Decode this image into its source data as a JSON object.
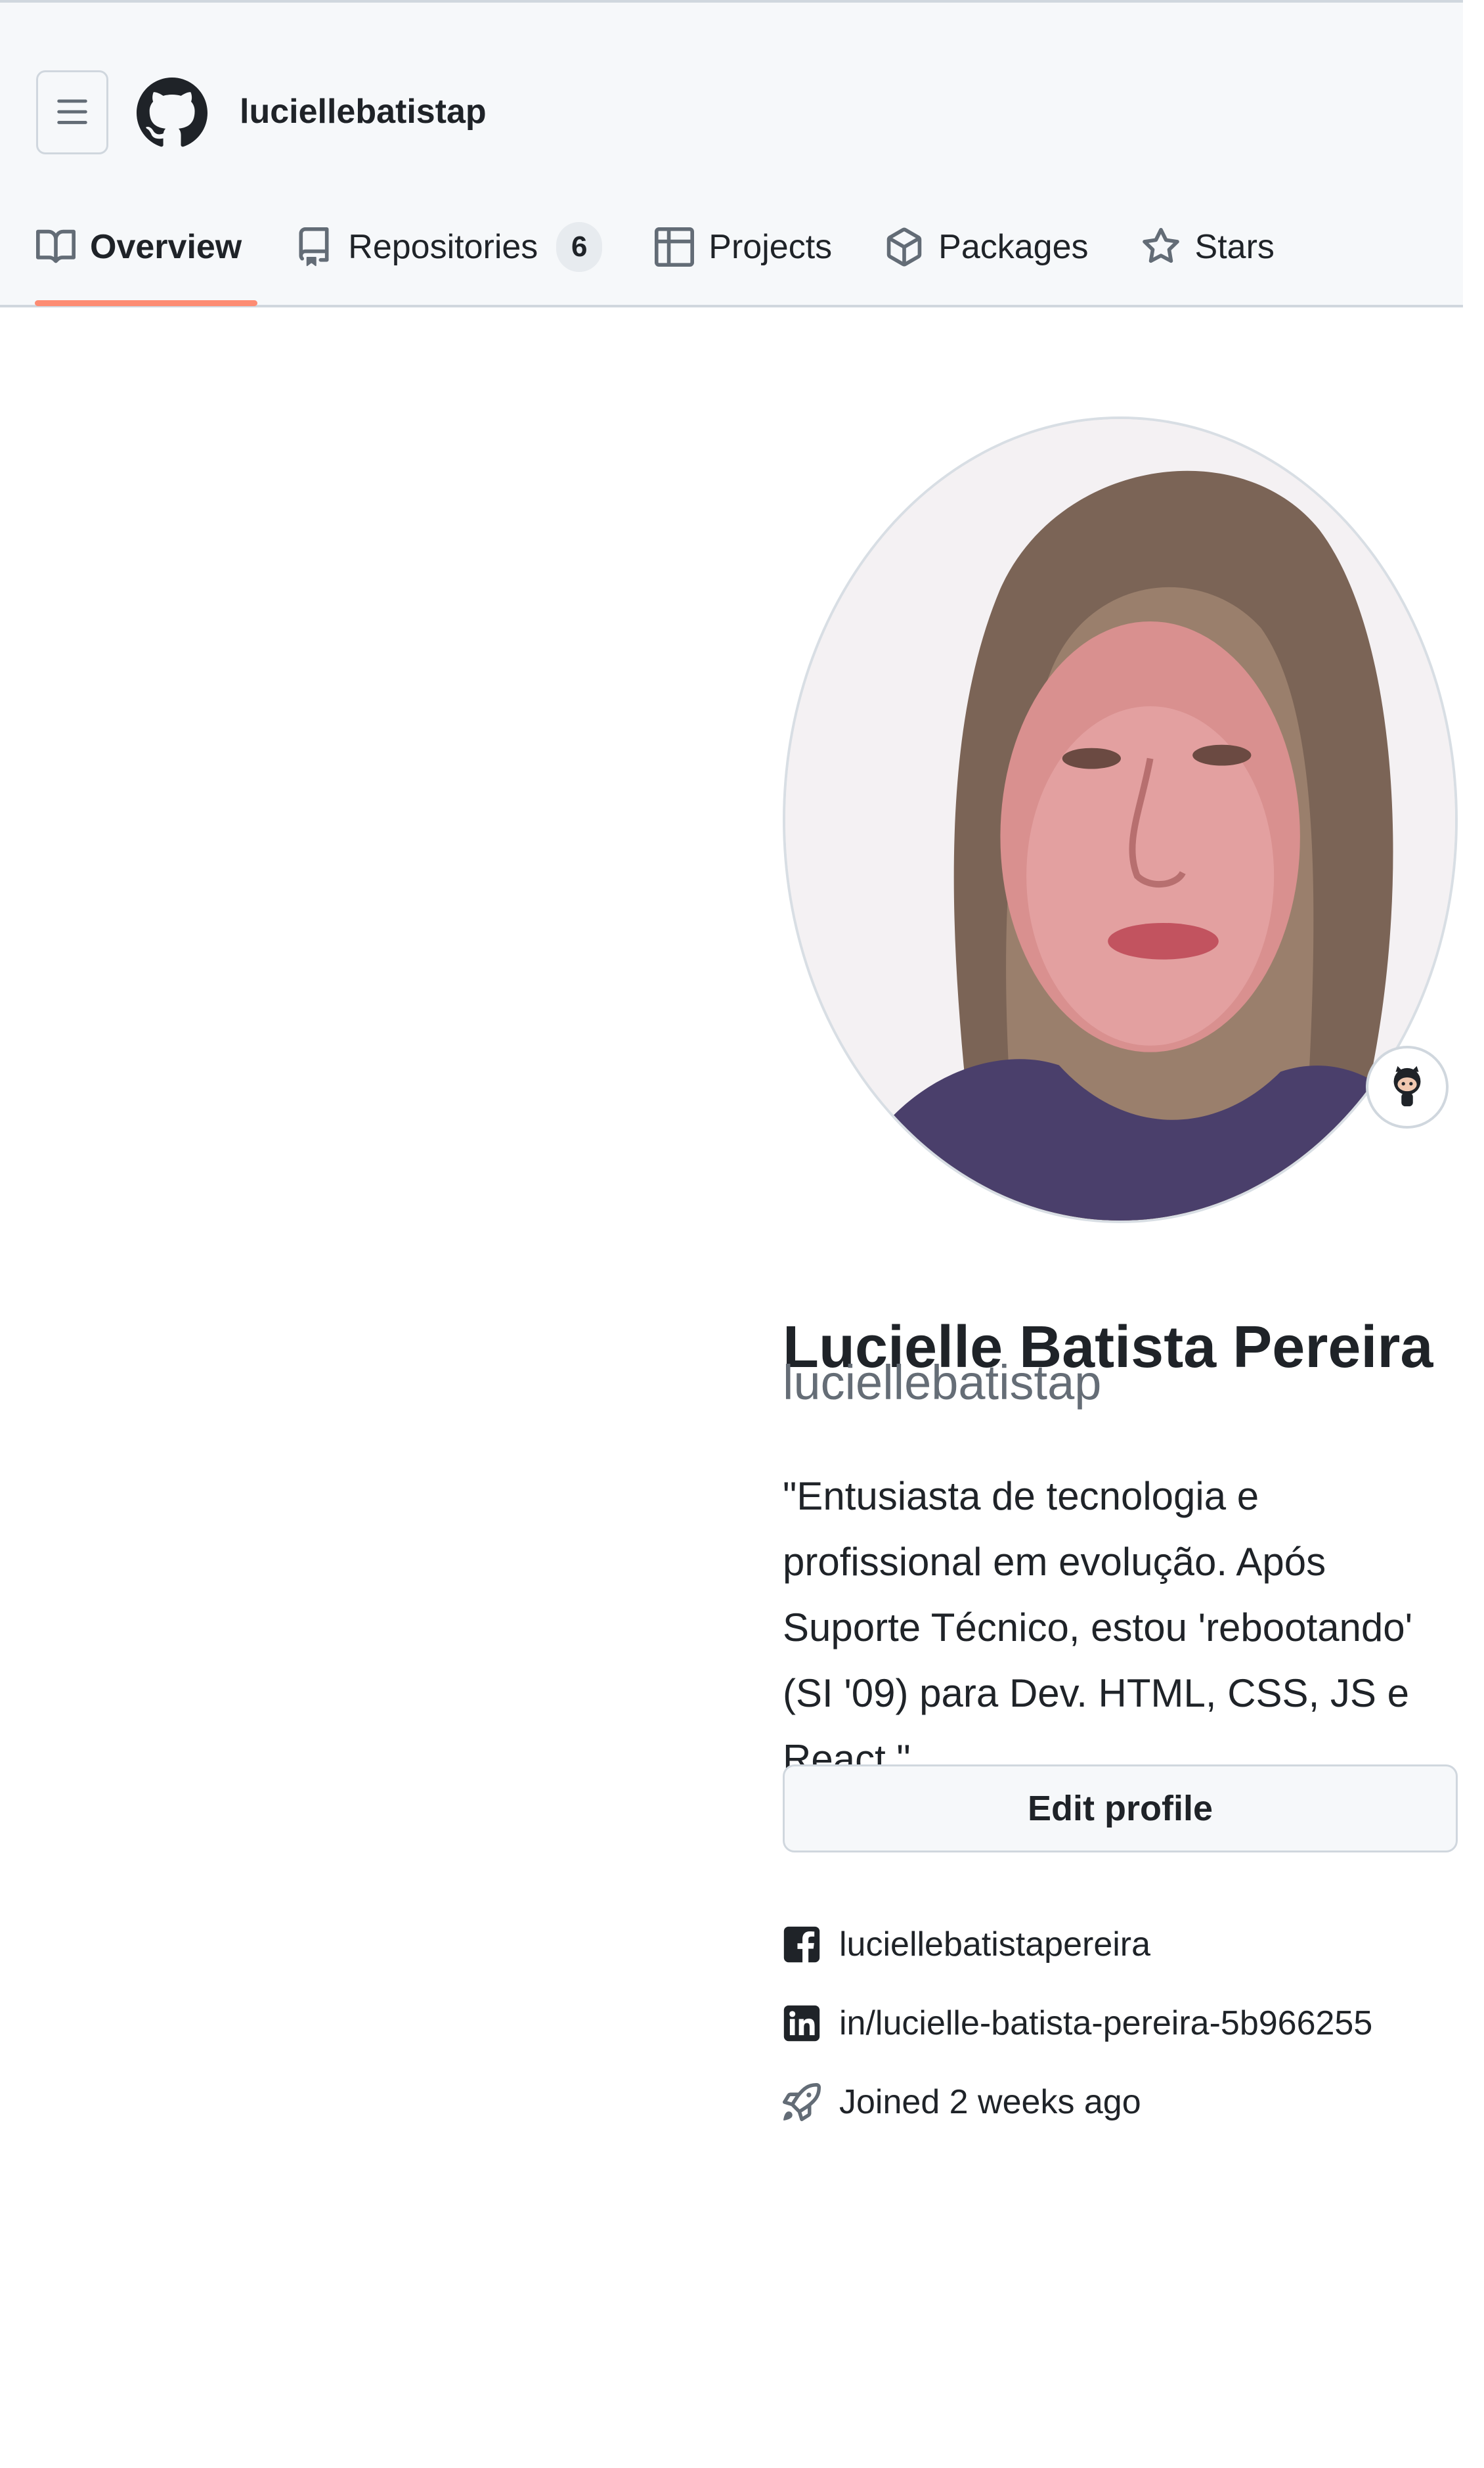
{
  "header": {
    "username": "luciellebatistap",
    "menu_icon": "hamburger-icon",
    "logo_icon": "github-mark-icon"
  },
  "tabs": [
    {
      "label": "Overview",
      "icon": "book-icon",
      "selected": true
    },
    {
      "label": "Repositories",
      "icon": "repo-icon",
      "counter": "6"
    },
    {
      "label": "Projects",
      "icon": "table-icon"
    },
    {
      "label": "Packages",
      "icon": "package-icon"
    },
    {
      "label": "Stars",
      "icon": "star-icon"
    }
  ],
  "profile": {
    "full_name": "Lucielle Batista Pereira",
    "login": "luciellebatistap",
    "bio": "\"Entusiasta de tecnologia e profissional em evolução. Após Suporte Técnico, estou 'rebootando' (SI '09) para Dev. HTML, CSS, JS e React.\"",
    "edit_button": "Edit profile",
    "status_icon": "octocat-status-icon"
  },
  "social": [
    {
      "icon": "facebook-icon",
      "text": "luciellebatistapereira"
    },
    {
      "icon": "linkedin-icon",
      "text": "in/lucielle-batista-pereira-5b966255"
    },
    {
      "icon": "rocket-icon",
      "text": "Joined 2 weeks ago"
    }
  ],
  "colors": {
    "accent_underline": "#fd8c73",
    "header_bg": "#f6f8fa",
    "muted_text": "#656d76",
    "border": "#d0d7de"
  }
}
